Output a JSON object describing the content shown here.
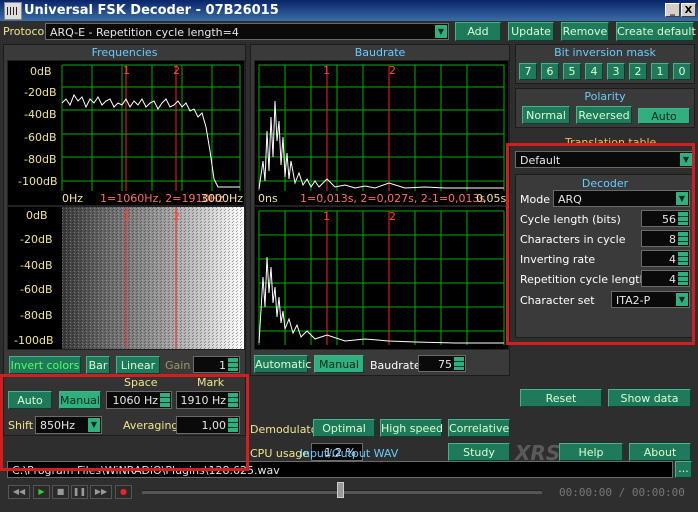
{
  "window": {
    "title": "Universal FSK Decoder - 07B26015",
    "min": "_",
    "close": "X"
  },
  "protocol": {
    "label": "Protocol",
    "value": "ARQ-E - Repetition cycle length=4"
  },
  "top_buttons": {
    "add": "Add",
    "update": "Update",
    "remove": "Remove",
    "create_default": "Create default"
  },
  "frequencies": {
    "title": "Frequencies",
    "db_labels": [
      "0dB",
      "-20dB",
      "-40dB",
      "-60dB",
      "-80dB",
      "-100dB"
    ],
    "x_start": "0Hz",
    "x_info": "1=1060Hz, 2=1910Hz",
    "x_end": "3000Hz",
    "marker1": "1",
    "marker2": "2",
    "wf_db_labels": [
      "0dB",
      "-20dB",
      "-40dB",
      "-60dB",
      "-80dB",
      "-100dB"
    ],
    "wf_marker1": "1",
    "wf_marker2": "2"
  },
  "baudrate_panel": {
    "title": "Baudrate",
    "x_start": "0ns",
    "x_info": "1=0,013s, 2=0,027s, 2-1=0,013s",
    "x_end": "0,05s",
    "marker1": "1",
    "marker2": "2",
    "marker1b": "1",
    "marker2b": "2"
  },
  "bit_inversion": {
    "title": "Bit inversion mask",
    "bits": [
      "7",
      "6",
      "5",
      "4",
      "3",
      "2",
      "1",
      "0"
    ]
  },
  "polarity": {
    "title": "Polarity",
    "normal": "Normal",
    "reversed": "Reversed",
    "auto": "Auto"
  },
  "translation": {
    "title": "Translation table",
    "value": "Default"
  },
  "decoder": {
    "title": "Decoder",
    "mode_label": "Mode",
    "mode_value": "ARQ",
    "rows": [
      {
        "label": "Cycle length (bits)",
        "value": "56"
      },
      {
        "label": "Characters in cycle",
        "value": "8"
      },
      {
        "label": "Inverting rate",
        "value": "4"
      },
      {
        "label": "Repetition cycle length",
        "value": "4"
      }
    ],
    "charset_label": "Character set",
    "charset_value": "ITA2-P"
  },
  "freq_controls": {
    "invert_colors": "Invert colors",
    "bar": "Bar",
    "linear": "Linear",
    "gain_label": "Gain",
    "gain_value": "1"
  },
  "baud_controls": {
    "automatic": "Automatic",
    "manual": "Manual",
    "baudrate_label": "Baudrate",
    "baudrate_value": "75"
  },
  "tuning": {
    "space_label": "Space",
    "mark_label": "Mark",
    "auto": "Auto",
    "manual": "Manual",
    "space_value": "1060 Hz",
    "mark_value": "1910 Hz",
    "shift_label": "Shift",
    "shift_value": "850Hz",
    "averaging_label": "Averaging",
    "averaging_value": "1,00"
  },
  "demod": {
    "label": "Demodulator",
    "optimal": "Optimal",
    "high_speed": "High speed",
    "correlative": "Correlative",
    "cpu_label": "CPU usage",
    "cpu_value": "1,2 %"
  },
  "right_buttons": {
    "reset": "Reset",
    "show_data": "Show data",
    "study": "Study",
    "logo": "XRS",
    "help": "Help",
    "about": "About"
  },
  "io": {
    "title": "Input/Output WAV",
    "path": "C:\\Program Files\\WiNRADiO\\Plugins\\128.625.wav",
    "browse": "...",
    "time": "00:00:00 / 00:00:00"
  },
  "transport_icons": [
    "rewind-icon",
    "play-icon",
    "stop-icon",
    "pause-icon",
    "fast-forward-icon",
    "record-icon"
  ],
  "colors": {
    "accent_green": "#2fb07e",
    "label_blue": "#66ccff",
    "grid_green": "#00b000",
    "marker_red": "#ff2020",
    "highlight_red": "#d21e1e"
  }
}
